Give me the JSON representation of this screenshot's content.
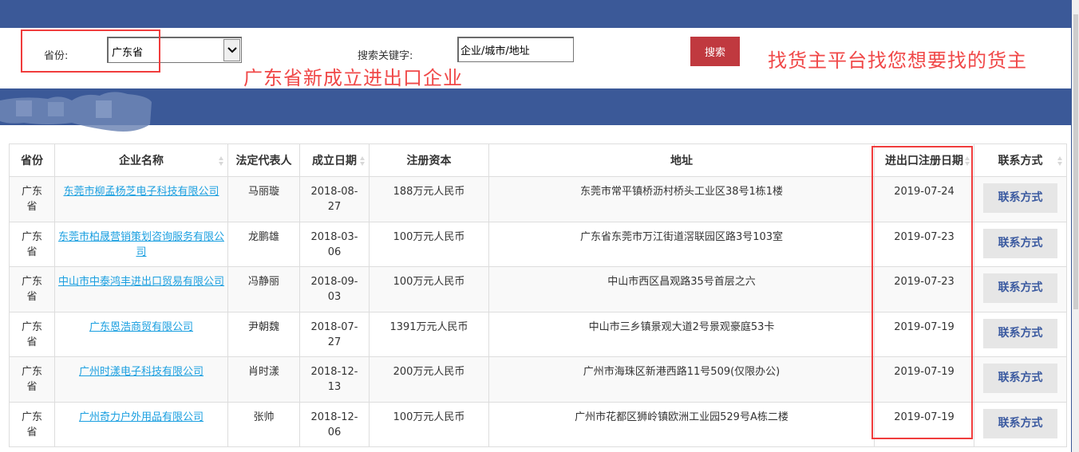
{
  "header": {
    "province_label": "省份:",
    "province_selected": "广东省",
    "keyword_label": "搜索关键字:",
    "keyword_value": "企业/城市/地址",
    "search_button": "搜索",
    "slogan_left": "广东省新成立进出口企业",
    "slogan_right": "找货主平台找您想要找的货主"
  },
  "colors": {
    "brand_blue": "#3b5998",
    "search_red": "#c0393f",
    "annotation_red": "#f03c3c",
    "link_blue": "#1a9fe0"
  },
  "table": {
    "columns": [
      {
        "label": "省份",
        "sortable": false
      },
      {
        "label": "企业名称",
        "sortable": true
      },
      {
        "label": "法定代表人",
        "sortable": false
      },
      {
        "label": "成立日期",
        "sortable": true
      },
      {
        "label": "注册资本",
        "sortable": false
      },
      {
        "label": "地址",
        "sortable": false
      },
      {
        "label": "进出口注册日期",
        "sortable": true
      },
      {
        "label": "联系方式",
        "sortable": true
      }
    ],
    "rows": [
      {
        "province": "广东省",
        "company": "东莞市柳孟杨芝电子科技有限公司",
        "legal_rep": "马丽璇",
        "founded": "2018-08-27",
        "capital": "188万元人民币",
        "address": "东莞市常平镇桥沥村桥头工业区38号1栋1楼",
        "ie_reg_date": "2019-07-24",
        "contact": "联系方式"
      },
      {
        "province": "广东省",
        "company": "东莞市柏晟营销策划咨询服务有限公司",
        "legal_rep": "龙鹏雄",
        "founded": "2018-03-06",
        "capital": "100万元人民币",
        "address": "广东省东莞市万江街道滘联园区路3号103室",
        "ie_reg_date": "2019-07-23",
        "contact": "联系方式"
      },
      {
        "province": "广东省",
        "company": "中山市中泰鸿丰进出口贸易有限公司",
        "legal_rep": "冯静丽",
        "founded": "2018-09-03",
        "capital": "100万元人民币",
        "address": "中山市西区昌观路35号首层之六",
        "ie_reg_date": "2019-07-23",
        "contact": "联系方式"
      },
      {
        "province": "广东省",
        "company": "广东恩浩商贸有限公司",
        "legal_rep": "尹朝魏",
        "founded": "2018-07-27",
        "capital": "1391万元人民币",
        "address": "中山市三乡镇景观大道2号景观豪庭53卡",
        "ie_reg_date": "2019-07-19",
        "contact": "联系方式"
      },
      {
        "province": "广东省",
        "company": "广州时漾电子科技有限公司",
        "legal_rep": "肖时漾",
        "founded": "2018-12-13",
        "capital": "200万元人民币",
        "address": "广州市海珠区新港西路11号509(仅限办公)",
        "ie_reg_date": "2019-07-19",
        "contact": "联系方式"
      },
      {
        "province": "广东省",
        "company": "广州奇力户外用品有限公司",
        "legal_rep": "张帅",
        "founded": "2018-12-06",
        "capital": "100万元人民币",
        "address": "广州市花都区狮岭镇欧洲工业园529号A栋二楼",
        "ie_reg_date": "2019-07-19",
        "contact": "联系方式"
      }
    ]
  }
}
